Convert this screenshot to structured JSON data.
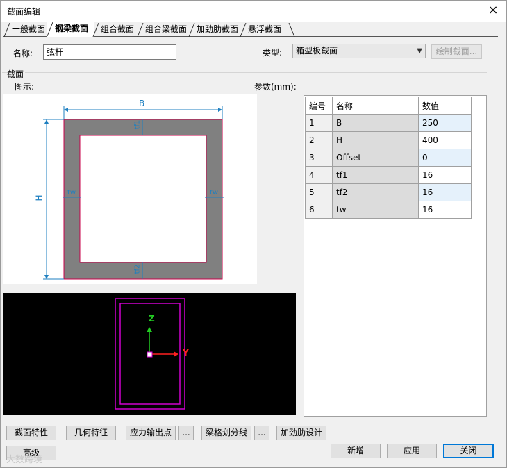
{
  "window": {
    "title": "截面编辑",
    "close_icon": "×"
  },
  "tabs": [
    {
      "label": "一般截面",
      "active": false
    },
    {
      "label": "钢梁截面",
      "active": true
    },
    {
      "label": "组合截面",
      "active": false
    },
    {
      "label": "组合梁截面",
      "active": false
    },
    {
      "label": "加劲肋截面",
      "active": false
    },
    {
      "label": "悬浮截面",
      "active": false
    }
  ],
  "form": {
    "name_label": "名称:",
    "name_value": "弦杆",
    "type_label": "类型:",
    "type_value": "箱型板截面",
    "draw_button": "绘制截面..."
  },
  "section": {
    "group_label": "截面",
    "diagram_label": "图示:",
    "params_label": "参数(mm):"
  },
  "diagram": {
    "labels": {
      "B": "B",
      "H": "H",
      "tf1": "tf1",
      "tf2": "tf2",
      "tw": "tw"
    },
    "colors": {
      "fill": "#808080",
      "outline": "#c8004a",
      "dim": "#1e7fc0"
    }
  },
  "viewer": {
    "axis_z": "Z",
    "axis_y": "Y",
    "colors": {
      "outline": "#d000d0",
      "z": "#22cc22",
      "y": "#ff2020"
    }
  },
  "params_table": {
    "headers": [
      "编号",
      "名称",
      "数值"
    ],
    "rows": [
      {
        "no": "1",
        "name": "B",
        "value": "250"
      },
      {
        "no": "2",
        "name": "H",
        "value": "400"
      },
      {
        "no": "3",
        "name": "Offset",
        "value": "0"
      },
      {
        "no": "4",
        "name": "tf1",
        "value": "16"
      },
      {
        "no": "5",
        "name": "tf2",
        "value": "16"
      },
      {
        "no": "6",
        "name": "tw",
        "value": "16"
      }
    ]
  },
  "buttons": {
    "section_props": "截面特性",
    "geometry": "几何特征",
    "stress_points": "应力输出点",
    "stress_more": "...",
    "mesh_lines": "梁格划分线",
    "mesh_more": "...",
    "stiffener": "加劲肋设计",
    "advanced": "高级",
    "add": "新增",
    "apply": "应用",
    "close": "关闭"
  },
  "watermark": "大数跨境"
}
